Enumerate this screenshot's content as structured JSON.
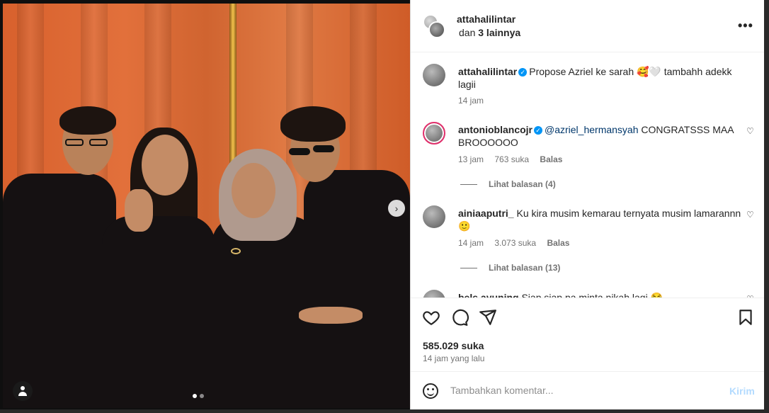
{
  "colors": {
    "accent": "#0095f6",
    "text": "#262626",
    "muted": "#737373",
    "post_disabled": "#b3dbff"
  },
  "photo": {
    "carousel_index": 1,
    "carousel_count": 2
  },
  "header": {
    "username": "attahalilintar",
    "others_prefix": "dan",
    "others_count": "3 lainnya",
    "more_icon": "more-horizontal-icon"
  },
  "caption": {
    "username": "attahalilintar",
    "verified": true,
    "text": "Propose Azriel ke sarah 🥰🤍 tambahh adekk lagii",
    "time": "14 jam"
  },
  "comments": [
    {
      "username": "antonioblancojr",
      "verified": true,
      "mention": "@azriel_hermansyah",
      "text": " CONGRATSSS MAA BROOOOOO",
      "time": "13 jam",
      "likes": "763 suka",
      "reply_label": "Balas",
      "view_replies": "Lihat balasan (4)"
    },
    {
      "username": "ainiaaputri_",
      "verified": false,
      "mention": "",
      "text": " Ku kira musim kemarau ternyata musim lamarannn 🙂",
      "time": "14 jam",
      "likes": "3.073 suka",
      "reply_label": "Balas",
      "view_replies": "Lihat balasan (13)"
    },
    {
      "username": "bels.ayuning",
      "verified": false,
      "mention": "",
      "text": " Siap siap pa minta nikah lagi 😂"
    }
  ],
  "actions": {
    "like_icon": "heart-icon",
    "comment_icon": "comment-icon",
    "share_icon": "send-icon",
    "save_icon": "bookmark-icon",
    "likes": "585.029 suka",
    "time": "14 jam yang lalu"
  },
  "add_comment": {
    "placeholder": "Tambahkan komentar...",
    "post_label": "Kirim"
  }
}
